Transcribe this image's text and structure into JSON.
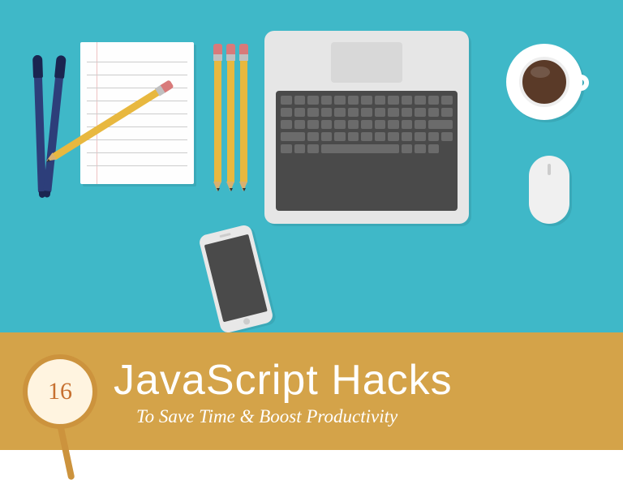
{
  "banner": {
    "number": "16",
    "title": "JavaScript Hacks",
    "subtitle": "To Save Time & Boost Productivity"
  },
  "colors": {
    "desk": "#3fb8c8",
    "banner": "#d4a349",
    "pencil": "#e8b83f",
    "pen": "#2d3e7a"
  },
  "items": {
    "pens": "blue-pens",
    "notepad": "notepad",
    "pencils": "pencils",
    "laptop": "laptop",
    "coffee": "coffee-cup",
    "mouse": "mouse",
    "phone": "smartphone"
  }
}
